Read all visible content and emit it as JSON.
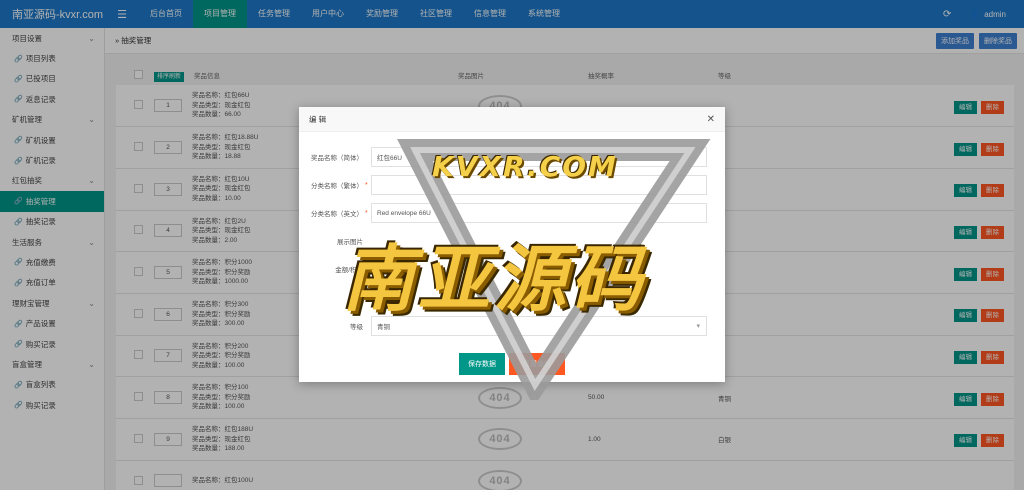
{
  "brand": "南亚源码-kvxr.com",
  "topnav": [
    {
      "label": "后台首页",
      "active": false
    },
    {
      "label": "项目管理",
      "active": true
    },
    {
      "label": "任务管理",
      "active": false
    },
    {
      "label": "用户中心",
      "active": false
    },
    {
      "label": "奖励管理",
      "active": false
    },
    {
      "label": "社区管理",
      "active": false
    },
    {
      "label": "信息管理",
      "active": false
    },
    {
      "label": "系统管理",
      "active": false
    }
  ],
  "user": "admin",
  "sidebar": [
    {
      "label": "项目设置",
      "type": "group"
    },
    {
      "label": "项目列表",
      "type": "sub"
    },
    {
      "label": "已投项目",
      "type": "sub"
    },
    {
      "label": "返息记录",
      "type": "sub"
    },
    {
      "label": "矿机管理",
      "type": "group"
    },
    {
      "label": "矿机设置",
      "type": "sub"
    },
    {
      "label": "矿机记录",
      "type": "sub"
    },
    {
      "label": "红包抽奖",
      "type": "group"
    },
    {
      "label": "抽奖管理",
      "type": "active"
    },
    {
      "label": "抽奖记录",
      "type": "sub"
    },
    {
      "label": "生活服务",
      "type": "group"
    },
    {
      "label": "充值缴费",
      "type": "sub"
    },
    {
      "label": "充值订单",
      "type": "sub"
    },
    {
      "label": "理财宝管理",
      "type": "group"
    },
    {
      "label": "产品设置",
      "type": "sub"
    },
    {
      "label": "购买记录",
      "type": "sub"
    },
    {
      "label": "盲盒管理",
      "type": "group"
    },
    {
      "label": "盲盒列表",
      "type": "sub"
    },
    {
      "label": "购买记录",
      "type": "sub"
    }
  ],
  "breadcrumb": "抽奖管理",
  "toolbar": {
    "add_label": "添加奖品",
    "delete_label": "删除奖品"
  },
  "table": {
    "sort_button": "排序刷新",
    "headers": [
      "奖品信息",
      "奖品图片",
      "抽奖概率",
      "等级"
    ],
    "rows": [
      {
        "sort": "1",
        "name": "奖品名称：红包66U",
        "type": "奖品类型：现金红包",
        "qty": "奖品数量：66.00",
        "prob": "",
        "level": ""
      },
      {
        "sort": "2",
        "name": "奖品名称：红包18.88U",
        "type": "奖品类型：现金红包",
        "qty": "奖品数量：18.88",
        "prob": "",
        "level": ""
      },
      {
        "sort": "3",
        "name": "奖品名称：红包10U",
        "type": "奖品类型：现金红包",
        "qty": "奖品数量：10.00",
        "prob": "",
        "level": ""
      },
      {
        "sort": "4",
        "name": "奖品名称：红包2U",
        "type": "奖品类型：现金红包",
        "qty": "奖品数量：2.00",
        "prob": "",
        "level": ""
      },
      {
        "sort": "5",
        "name": "奖品名称：积分1000",
        "type": "奖品类型：积分奖励",
        "qty": "奖品数量：1000.00",
        "prob": "",
        "level": ""
      },
      {
        "sort": "6",
        "name": "奖品名称：积分300",
        "type": "奖品类型：积分奖励",
        "qty": "奖品数量：300.00",
        "prob": "",
        "level": ""
      },
      {
        "sort": "7",
        "name": "奖品名称：积分200",
        "type": "奖品类型：积分奖励",
        "qty": "奖品数量：100.00",
        "prob": "",
        "level": ""
      },
      {
        "sort": "8",
        "name": "奖品名称：积分100",
        "type": "奖品类型：积分奖励",
        "qty": "奖品数量：100.00",
        "prob": "50.00",
        "level": "青铜"
      },
      {
        "sort": "9",
        "name": "奖品名称：红包188U",
        "type": "奖品类型：现金红包",
        "qty": "奖品数量：188.00",
        "prob": "1.00",
        "level": "白银"
      },
      {
        "sort": "",
        "name": "奖品名称：红包100U",
        "type": "",
        "qty": "",
        "prob": "",
        "level": ""
      }
    ],
    "img_placeholder": "404",
    "edit_label": "编辑",
    "delete_label": "删除",
    "partial_level": "铜"
  },
  "modal": {
    "title": "编 辑",
    "fields": [
      {
        "label": "奖品名称（简体）",
        "required": false,
        "value": "红包66U",
        "select": false
      },
      {
        "label": "分类名称（繁体）",
        "required": true,
        "value": "",
        "select": false
      },
      {
        "label": "分类名称（英文）",
        "required": true,
        "value": "Red envelope 66U",
        "select": false
      },
      {
        "label": "展示图片",
        "required": false,
        "value": "",
        "select": false
      },
      {
        "label": "金额/积分",
        "required": false,
        "value": "66.00",
        "select": false
      },
      {
        "label": "等级",
        "required": false,
        "value": "青铜",
        "select": true
      }
    ],
    "save_label": "保存数据",
    "reset_label": "重置编辑"
  },
  "watermark": {
    "en": "KVXR.COM",
    "cn": "南亚源码"
  },
  "colors": {
    "topbar": "#1e78c8",
    "accent": "#009688",
    "danger": "#ff5722",
    "blue_button": "#3d7fd0"
  }
}
